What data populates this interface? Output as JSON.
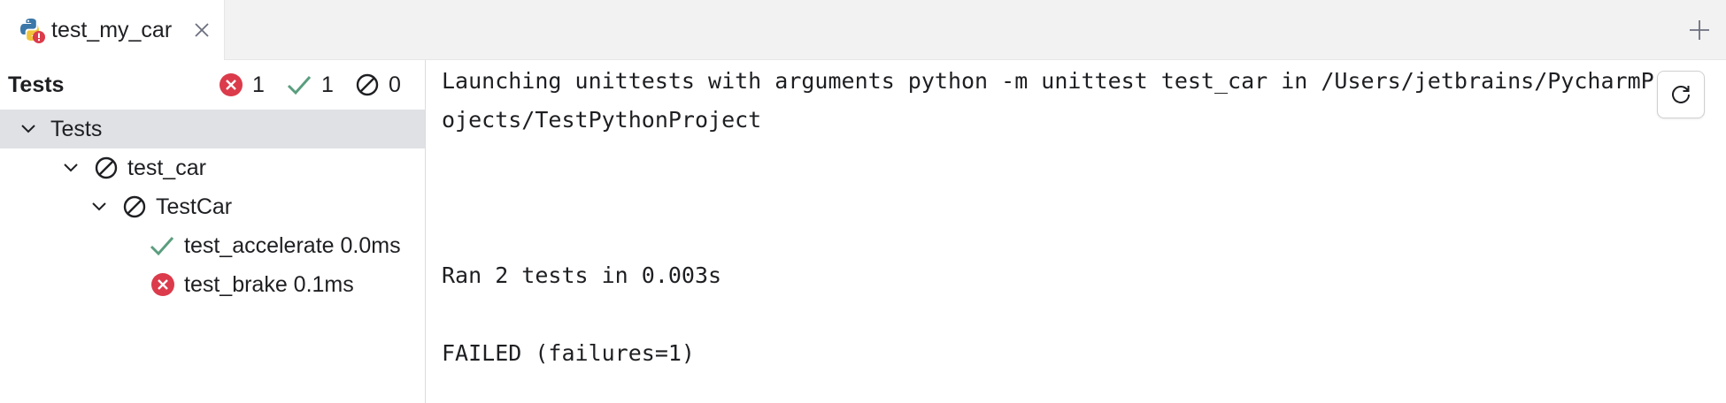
{
  "tab": {
    "title": "test_my_car",
    "icon": "python-error-icon"
  },
  "tests_panel": {
    "title": "Tests",
    "counts": {
      "failed": "1",
      "passed": "1",
      "ignored": "0"
    },
    "tree": [
      {
        "label": "Tests",
        "status": "root",
        "selected": true
      },
      {
        "label": "test_car",
        "status": "ignored"
      },
      {
        "label": "TestCar",
        "status": "ignored"
      },
      {
        "label": "test_accelerate 0.0ms",
        "status": "passed"
      },
      {
        "label": "test_brake 0.1ms",
        "status": "failed"
      }
    ]
  },
  "console": {
    "lines": [
      "Launching unittests with arguments python -m unittest test_car in /Users/jetbrains/PycharmPr",
      "ojects/TestPythonProject",
      "Ran 2 tests in 0.003s",
      "FAILED (failures=1)"
    ]
  },
  "colors": {
    "failed": "#db3b4b",
    "passed": "#5a9e7e",
    "ignored": "#1e1f22",
    "selected_row": "#dfe1e5"
  }
}
